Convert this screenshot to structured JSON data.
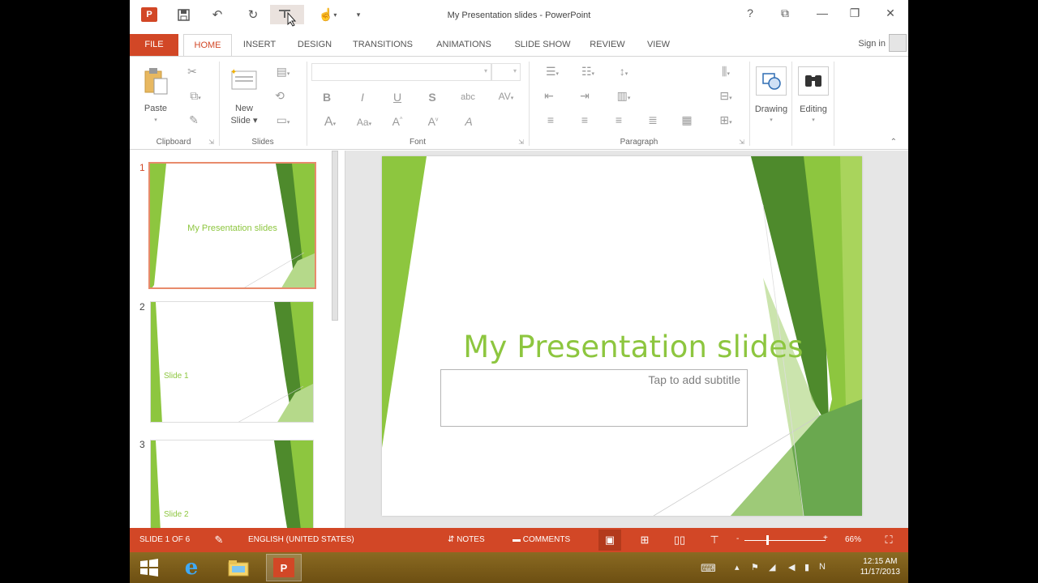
{
  "window": {
    "title": "My Presentation slides - PowerPoint",
    "app_icon_letter": "P",
    "controls": {
      "help": "?",
      "ribbon_display": "⧉",
      "minimize": "—",
      "restore": "❐",
      "close": "✕"
    }
  },
  "quick_access": {
    "save_icon": "save-icon",
    "undo_icon": "undo-icon",
    "redo_icon": "redo-icon",
    "start_from_beginning_icon": "presentation-icon",
    "touch_mode_icon": "touch-icon",
    "customize_icon": "customize-qat-icon"
  },
  "tabs": {
    "file": "FILE",
    "home": "HOME",
    "insert": "INSERT",
    "design": "DESIGN",
    "transitions": "TRANSITIONS",
    "animations": "ANIMATIONS",
    "slide_show": "SLIDE SHOW",
    "review": "REVIEW",
    "view": "VIEW"
  },
  "account": {
    "sign_in": "Sign in"
  },
  "ribbon": {
    "clipboard": {
      "label": "Clipboard",
      "paste": "Paste"
    },
    "slides": {
      "label": "Slides",
      "new_slide_line1": "New",
      "new_slide_line2": "Slide ▾"
    },
    "font": {
      "label": "Font",
      "bold": "B",
      "italic": "I",
      "underline": "U",
      "shadow": "S",
      "strike": "abc",
      "spacing": "AV",
      "font_color": "A",
      "case": "Aa",
      "grow": "A",
      "shrink": "A",
      "clear": "A"
    },
    "paragraph": {
      "label": "Paragraph"
    },
    "drawing": {
      "label": "Drawing"
    },
    "editing": {
      "label": "Editing"
    }
  },
  "thumbnails": [
    {
      "number": "1",
      "title": "My Presentation slides",
      "label": ""
    },
    {
      "number": "2",
      "title": "",
      "label": "Slide 1"
    },
    {
      "number": "3",
      "title": "",
      "label": "Slide 2"
    }
  ],
  "slide": {
    "title": "My Presentation slides",
    "subtitle_placeholder": "Tap to add subtitle",
    "accent_colors": [
      "#8dc63f",
      "#6aa84f",
      "#4e8a2c",
      "#b5d98a"
    ]
  },
  "statusbar": {
    "slide_count": "SLIDE 1 OF 6",
    "language": "ENGLISH (UNITED STATES)",
    "notes": "NOTES",
    "comments": "COMMENTS",
    "zoom_minus": "-",
    "zoom_plus": "+",
    "zoom": "66%",
    "zoom_level": 0.66
  },
  "taskbar": {
    "time": "12:15 AM",
    "date": "11/17/2013"
  },
  "colors": {
    "accent": "#d24726",
    "slide_green": "#8dc63f"
  }
}
